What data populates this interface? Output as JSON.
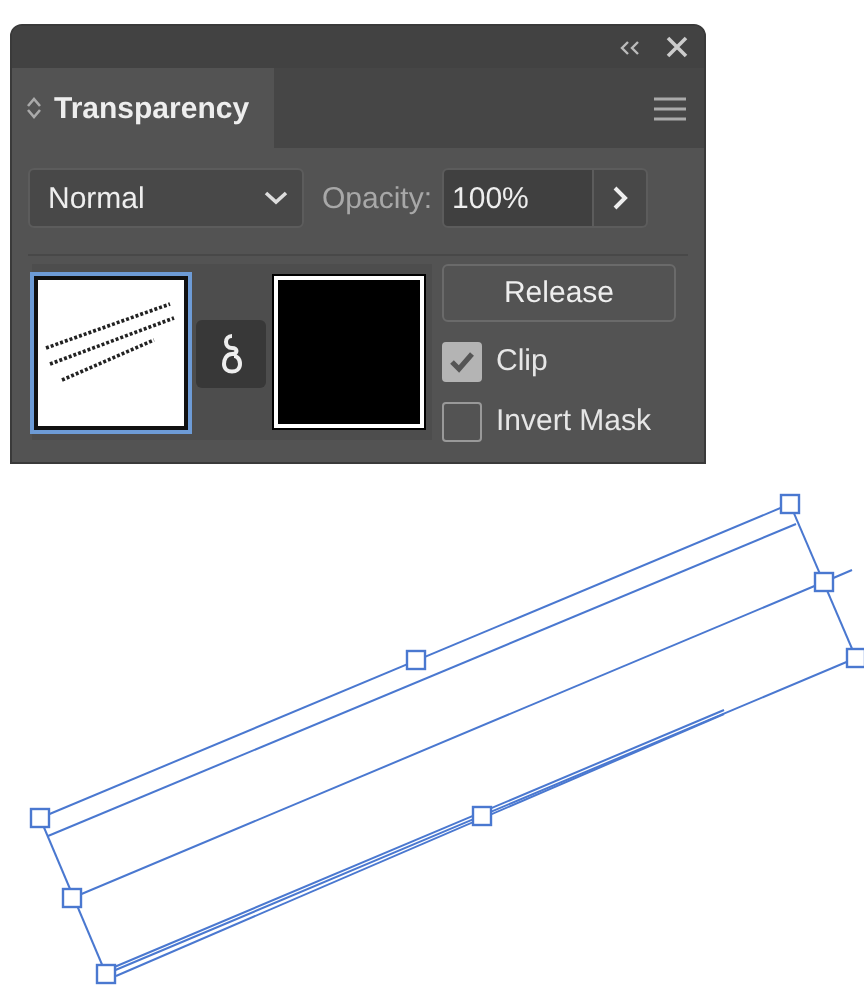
{
  "panel": {
    "tab": {
      "label": "Transparency",
      "selected": true
    },
    "blend_mode": {
      "value": "Normal"
    },
    "opacity": {
      "label": "Opacity:",
      "value": "100%"
    },
    "release_button": {
      "label": "Release"
    },
    "options": [
      {
        "label": "Clip",
        "checked": true
      },
      {
        "label": "Invert Mask",
        "checked": false
      }
    ]
  }
}
